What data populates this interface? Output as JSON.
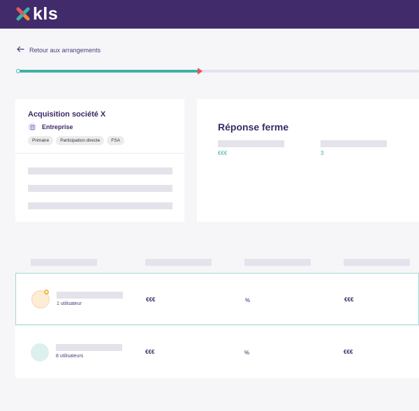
{
  "header": {
    "logo_text": "kls",
    "brand_color": "#412b6b"
  },
  "nav": {
    "back_label": "Retour aux arrangements"
  },
  "progress": {
    "fraction": 0.455,
    "fill_color": "#3bb3aa",
    "marker_color": "#e4565a"
  },
  "deal": {
    "title": "Acquisition société X",
    "entity": "Entreprise",
    "entity_icon": "building-icon",
    "tags": [
      "Primaire",
      "Participation directe",
      "FSA"
    ]
  },
  "response": {
    "title": "Réponse ferme",
    "value_1": "€€€",
    "value_2": "3"
  },
  "rows": [
    {
      "users": "1 utilisateur",
      "amount": "€€€",
      "percent": "%",
      "total": "€€€",
      "avatar_color": "#fdecd6",
      "selected": true
    },
    {
      "users": "8 utilisateurs",
      "amount": "€€€",
      "percent": "%",
      "total": "€€€",
      "avatar_color": "#dcf1ee",
      "selected": false
    }
  ]
}
